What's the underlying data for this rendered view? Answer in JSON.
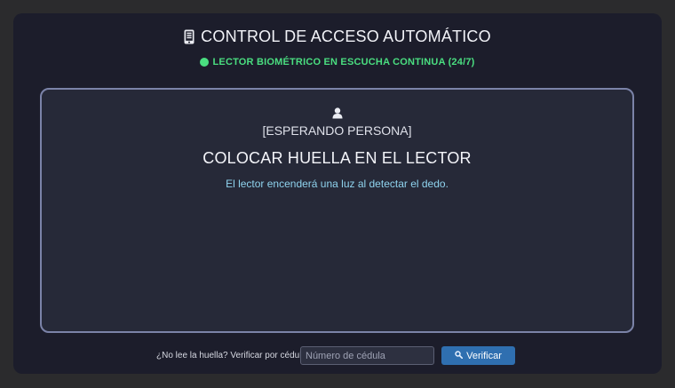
{
  "header": {
    "title": "CONTROL DE ACCESO AUTOMÁTICO",
    "title_icon": "mobile-phone-icon",
    "status_text": "LECTOR BIOMÉTRICO EN ESCUCHA CONTINUA (24/7)",
    "status_icon": "green-dot-icon"
  },
  "reader": {
    "person_icon": "person-icon",
    "state_label": "[ESPERANDO PERSONA]",
    "instruction": "COLOCAR HUELLA EN EL LECTOR",
    "hint": "El lector encenderá una luz al detectar el dedo."
  },
  "fallback": {
    "label": "¿No lee la huella? Verificar por cédula:",
    "input_placeholder": "Número de cédula",
    "input_value": "",
    "button_label": "Verificar",
    "button_icon": "magnifier-icon"
  },
  "colors": {
    "background": "#2b2b2d",
    "panel": "#1c1d2b",
    "reader_panel": "#262938",
    "reader_border": "#7b83a8",
    "status_green": "#4ade80",
    "hint_cyan": "#8fd3ee",
    "button_blue": "#2f6fb0"
  }
}
